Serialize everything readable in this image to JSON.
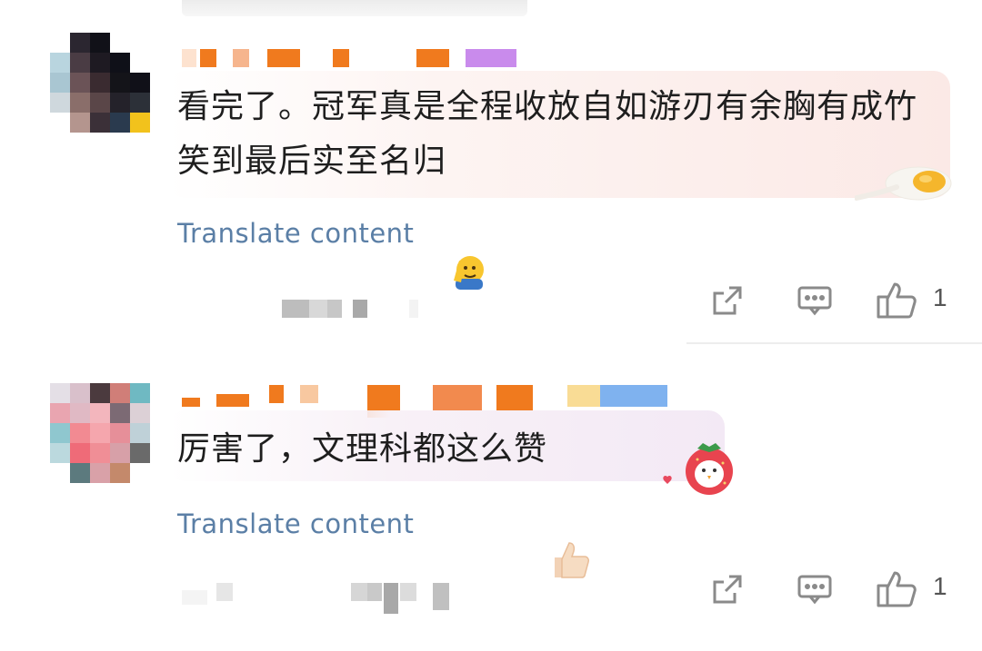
{
  "comments": [
    {
      "text": "看完了。冠军真是全程收放自如游刃有余胸有成竹笑到最后实至名归",
      "translate_label": "Translate content",
      "like_count": "1",
      "emoji": "saluting-face-emoji",
      "sticker": "fried-egg-sticker"
    },
    {
      "text": "厉害了，文理科都这么赞",
      "translate_label": "Translate content",
      "like_count": "1",
      "emoji": "thumbs-up-emoji",
      "sticker": "strawberry-bird-sticker"
    }
  ],
  "icons": {
    "share": "share-icon",
    "comment": "comment-icon",
    "like": "thumbs-up-icon"
  },
  "colors": {
    "translate_link": "#5b7fa6",
    "icon_gray": "#8a8a8a",
    "username_orange": "#f07a1e",
    "username_purple": "#c98bec"
  }
}
